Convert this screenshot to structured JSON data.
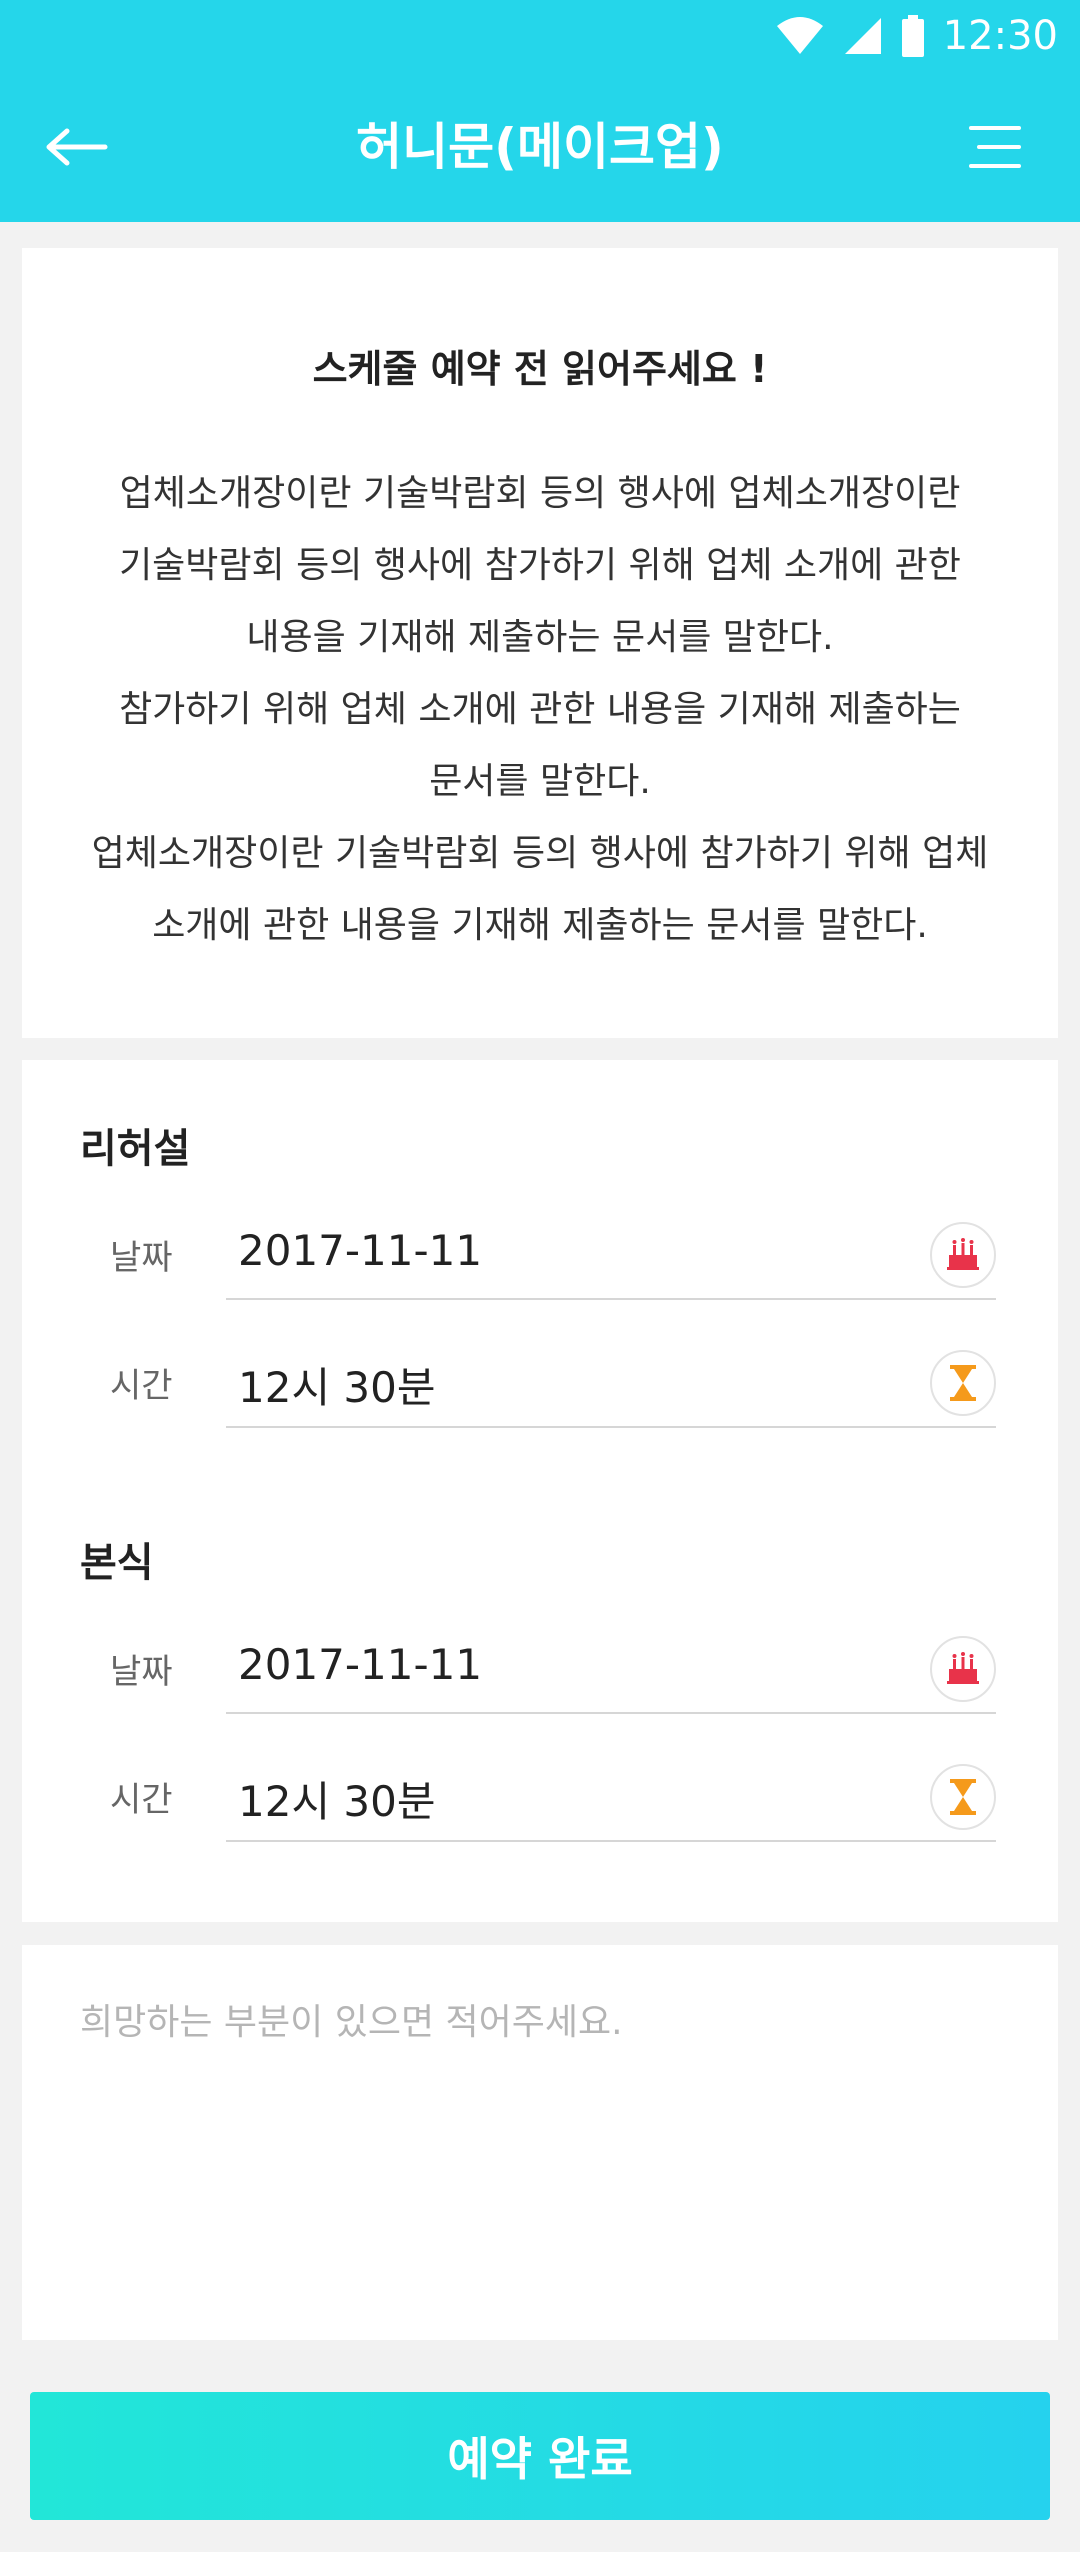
{
  "status_bar": {
    "time": "12:30"
  },
  "header": {
    "title": "허니문(메이크업)"
  },
  "notice": {
    "title": "스케줄 예약 전 읽어주세요 !",
    "lines": [
      "업체소개장이란 기술박람회 등의 행사에 업체소개장이란",
      "기술박람회 등의 행사에 참가하기 위해 업체 소개에 관한",
      "내용을 기재해 제출하는 문서를 말한다.",
      "참가하기 위해 업체 소개에 관한 내용을 기재해 제출하는",
      "문서를 말한다.",
      "업체소개장이란 기술박람회 등의 행사에 참가하기 위해 업체",
      "소개에 관한 내용을 기재해 제출하는 문서를 말한다."
    ]
  },
  "rehearsal": {
    "label": "리허설",
    "date_label": "날짜",
    "date_value": "2017-11-11",
    "time_label": "시간",
    "time_value": "12시 30분"
  },
  "ceremony": {
    "label": "본식",
    "date_label": "날짜",
    "date_value": "2017-11-11",
    "time_label": "시간",
    "time_value": "12시 30분"
  },
  "memo": {
    "placeholder": "희망하는 부분이 있으면 적어주세요."
  },
  "submit": {
    "label": "예약 완료"
  },
  "colors": {
    "accent": "#25d6ea",
    "highlight": "#fdf39a",
    "cake": "#e8334a",
    "hourglass": "#f59a1b"
  },
  "icons": {
    "back": "arrow-left-icon",
    "menu": "menu-icon",
    "date": "cake-icon",
    "time": "hourglass-icon"
  }
}
